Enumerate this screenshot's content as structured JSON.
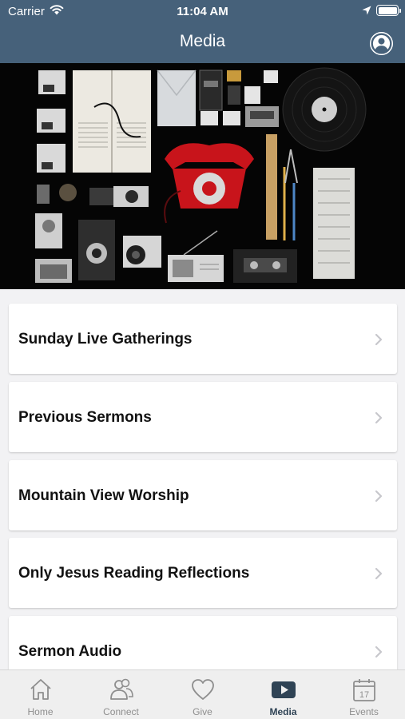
{
  "status_bar": {
    "carrier": "Carrier",
    "time": "11:04 AM"
  },
  "header": {
    "title": "Media"
  },
  "menu": {
    "items": [
      {
        "label": "Sunday Live Gatherings"
      },
      {
        "label": "Previous Sermons"
      },
      {
        "label": "Mountain View Worship"
      },
      {
        "label": "Only Jesus Reading Reflections"
      },
      {
        "label": "Sermon Audio"
      }
    ]
  },
  "tab_bar": {
    "tabs": [
      {
        "label": "Home",
        "icon": "home-icon"
      },
      {
        "label": "Connect",
        "icon": "people-icon"
      },
      {
        "label": "Give",
        "icon": "heart-icon"
      },
      {
        "label": "Media",
        "icon": "play-icon",
        "active": true
      },
      {
        "label": "Events",
        "icon": "calendar-icon"
      }
    ]
  },
  "colors": {
    "header_bg": "#46617a",
    "active_tab": "#2f4355",
    "inactive_tab": "#8e8e8e",
    "telephone": "#c8141b"
  }
}
